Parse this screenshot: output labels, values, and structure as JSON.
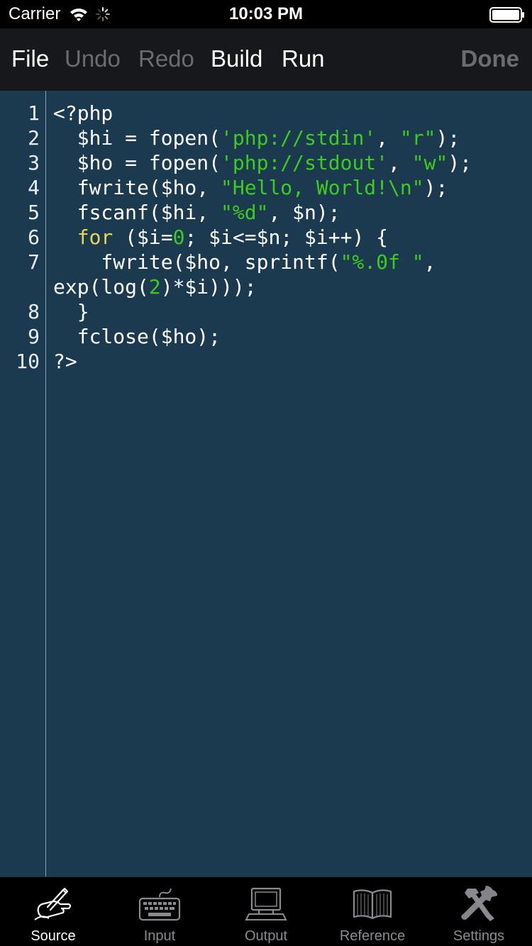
{
  "status_bar": {
    "carrier": "Carrier",
    "time": "10:03 PM"
  },
  "toolbar": {
    "file_label": "File",
    "undo_label": "Undo",
    "redo_label": "Redo",
    "build_label": "Build",
    "run_label": "Run",
    "done_label": "Done",
    "enabled_color": "#ffffff",
    "disabled_color": "#6c6c70"
  },
  "editor": {
    "background_color": "#1b3a50",
    "string_color": "#3ccc1c",
    "keyword_color": "#e6d84f",
    "line_numbers": [
      "1",
      "2",
      "3",
      "4",
      "5",
      "6",
      "7",
      "8",
      "9",
      "10"
    ],
    "lines": [
      [
        {
          "t": "<?php",
          "k": "plain"
        }
      ],
      [
        {
          "t": "  $hi = fopen(",
          "k": "plain"
        },
        {
          "t": "'php://stdin'",
          "k": "str"
        },
        {
          "t": ", ",
          "k": "plain"
        },
        {
          "t": "\"r\"",
          "k": "str"
        },
        {
          "t": ");",
          "k": "plain"
        }
      ],
      [
        {
          "t": "  $ho = fopen(",
          "k": "plain"
        },
        {
          "t": "'php://stdout'",
          "k": "str"
        },
        {
          "t": ", ",
          "k": "plain"
        },
        {
          "t": "\"w\"",
          "k": "str"
        },
        {
          "t": ");",
          "k": "plain"
        }
      ],
      [
        {
          "t": "  fwrite($ho, ",
          "k": "plain"
        },
        {
          "t": "\"Hello, World!\\n\"",
          "k": "str"
        },
        {
          "t": ");",
          "k": "plain"
        }
      ],
      [
        {
          "t": "  fscanf($hi, ",
          "k": "plain"
        },
        {
          "t": "\"%d\"",
          "k": "str"
        },
        {
          "t": ", $n);",
          "k": "plain"
        }
      ],
      [
        {
          "t": "  ",
          "k": "plain"
        },
        {
          "t": "for",
          "k": "kw"
        },
        {
          "t": " ($i=",
          "k": "plain"
        },
        {
          "t": "0",
          "k": "num"
        },
        {
          "t": "; $i<=$n; $i++) {",
          "k": "plain"
        }
      ],
      [
        {
          "t": "    fwrite($ho, sprintf(",
          "k": "plain"
        },
        {
          "t": "\"%.0f \"",
          "k": "str"
        },
        {
          "t": ",",
          "k": "plain"
        }
      ],
      [
        {
          "t": "exp(log(",
          "k": "plain"
        },
        {
          "t": "2",
          "k": "num"
        },
        {
          "t": ")*$i)));",
          "k": "plain"
        }
      ],
      [
        {
          "t": "  }",
          "k": "plain"
        }
      ],
      [
        {
          "t": "  fclose($ho);",
          "k": "plain"
        }
      ],
      [
        {
          "t": "?>",
          "k": "plain"
        }
      ]
    ]
  },
  "tabbar": {
    "tabs": [
      {
        "label": "Source",
        "icon": "pen-hand-icon",
        "active": true
      },
      {
        "label": "Input",
        "icon": "keyboard-icon",
        "active": false
      },
      {
        "label": "Output",
        "icon": "computer-icon",
        "active": false
      },
      {
        "label": "Reference",
        "icon": "book-icon",
        "active": false
      },
      {
        "label": "Settings",
        "icon": "tools-icon",
        "active": false
      }
    ]
  }
}
